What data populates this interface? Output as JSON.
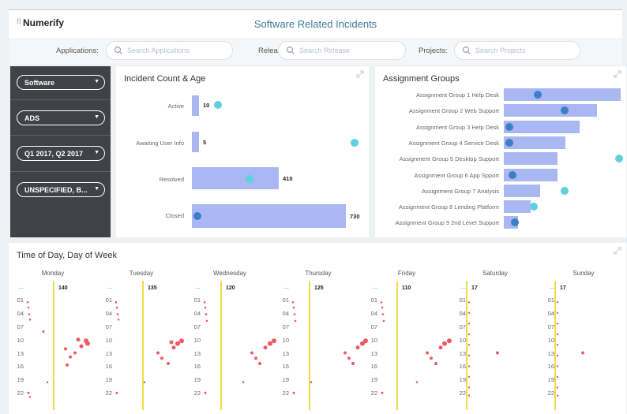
{
  "header": {
    "brand": "Numerify",
    "title": "Software Related Incidents"
  },
  "filters": {
    "applications_label": "Applications:",
    "applications_placeholder": "Search Applications",
    "release_label": "Release:",
    "release_placeholder": "Search Release",
    "projects_label": "Projects:",
    "projects_placeholder": "Search Projects"
  },
  "sidebar": {
    "items": [
      {
        "label": "Software"
      },
      {
        "label": "ADS"
      },
      {
        "label": "Q1 2017, Q2 2017"
      },
      {
        "label": "UNSPECIFIED, B..."
      }
    ]
  },
  "incident_panel": {
    "title": "Incident Count & Age",
    "rows": [
      {
        "label": "Active",
        "count": 10,
        "value_label": "10"
      },
      {
        "label": "Awaiting User Info",
        "count": 5,
        "value_label": "5"
      },
      {
        "label": "Resolved",
        "count": 410,
        "value_label": "410"
      },
      {
        "label": "Closed",
        "count": 730,
        "value_label": "730"
      }
    ]
  },
  "assignment_panel": {
    "title": "Assignment Groups",
    "rows": [
      {
        "label": "Assignment Group 1 Help Desk",
        "share": 1.0
      },
      {
        "label": "Assignment Group 2 Web Support",
        "share": 0.8
      },
      {
        "label": "Assignment Group 3 Help Desk",
        "share": 0.65
      },
      {
        "label": "Assignment Group 4 Service Desk",
        "share": 0.53
      },
      {
        "label": "Assignment Group 5 Desktop Support",
        "share": 0.46
      },
      {
        "label": "Assignment Group 6 App Spport",
        "share": 0.46
      },
      {
        "label": "Assignment Group 7 Analysis",
        "share": 0.31
      },
      {
        "label": "Assignment Group 8 Lending Platform",
        "share": 0.23
      },
      {
        "label": "Assignment Group 9 2nd Level Support",
        "share": 0.12
      }
    ]
  },
  "time_panel": {
    "title": "Time of Day, Day of Week",
    "hours": [
      "...",
      "01",
      "04",
      "07",
      "10",
      "13",
      "16",
      "19",
      "22"
    ],
    "days": [
      {
        "name": "Monday",
        "total": "140"
      },
      {
        "name": "Tuesday",
        "total": "135"
      },
      {
        "name": "Wednesday",
        "total": "120"
      },
      {
        "name": "Thursday",
        "total": "125"
      },
      {
        "name": "Friday",
        "total": "110"
      },
      {
        "name": "Saturday",
        "total": "17"
      },
      {
        "name": "Sunday",
        "total": "17"
      }
    ]
  },
  "colors": {
    "bar": "#a9b7f3",
    "dot_teal": "#5fd0dc",
    "dot_blue": "#3e7fc5",
    "heat_dot": "#ee5a63",
    "day_line": "#f1dd45",
    "sidebar_bg": "#3f4247",
    "title_blue": "#3f7a9a"
  },
  "icons": [
    "search-icon",
    "expand-icon",
    "chevron-down-icon"
  ]
}
